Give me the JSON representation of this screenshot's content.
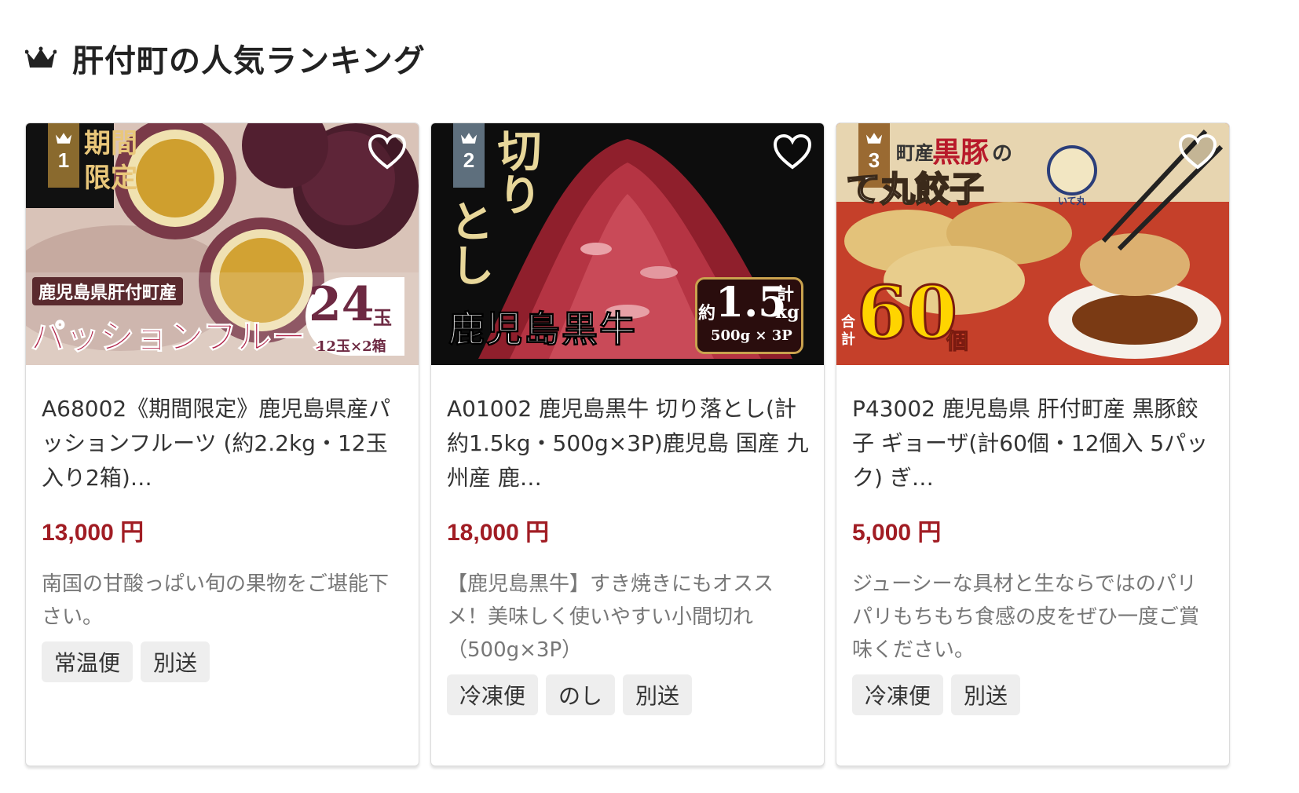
{
  "section": {
    "title": "肝付町の人気ランキング",
    "icon": "crown-icon"
  },
  "colors": {
    "price": "#a11d24",
    "rank1": "#8a6a2e",
    "rank2": "#5e6f7d",
    "rank3": "#9a6a32",
    "tag_bg": "#eeeeee"
  },
  "cards": [
    {
      "rank": "1",
      "image_label_region": "鹿児島県肝付町産",
      "image_label_product": "パッションフルーツ",
      "image_label_count": "24",
      "image_label_unit": "玉",
      "image_label_pack": "12玉×2箱",
      "image_label_corner_top": "期間",
      "image_label_corner_bottom": "限定",
      "name": "A68002《期間限定》鹿児島県産パッションフルーツ (約2.2kg・12玉入り2箱)…",
      "price": "13,000 円",
      "description": "南国の甘酸っぱい旬の果物をご堪能下さい。",
      "tags": [
        "常温便",
        "別送"
      ]
    },
    {
      "rank": "2",
      "image_label_vertical_1": "切り",
      "image_label_vertical_2": "とし",
      "image_label_brand": "鹿児島黒牛",
      "image_label_weight_prefix": "約",
      "image_label_weight": "1.5",
      "image_label_weight_unit": "kg",
      "image_label_total": "計",
      "image_label_pack": "500g × 3P",
      "name": "A01002 鹿児島黒牛 切り落とし(計約1.5kg・500g×3P)鹿児島 国産 九州産 鹿…",
      "price": "18,000 円",
      "description": "【鹿児島黒牛】すき焼きにもオススメ！美味しく使いやすい小間切れ（500g×3P）",
      "tags": [
        "冷凍便",
        "のし",
        "別送"
      ]
    },
    {
      "rank": "3",
      "image_label_top": "町産",
      "image_label_kurobuta": "黒豚",
      "image_label_no": "の",
      "image_label_product": "て丸餃子",
      "image_label_total_1": "合",
      "image_label_total_2": "計",
      "image_label_count": "60",
      "image_label_unit": "個",
      "image_label_mascot": "いて丸",
      "name": "P43002 鹿児島県 肝付町産 黒豚餃子 ギョーザ(計60個・12個入 5パック) ぎ…",
      "price": "5,000 円",
      "description": "ジューシーな具材と生ならではのパリパリもちもち食感の皮をぜひ一度ご賞味ください。",
      "tags": [
        "冷凍便",
        "別送"
      ]
    }
  ]
}
